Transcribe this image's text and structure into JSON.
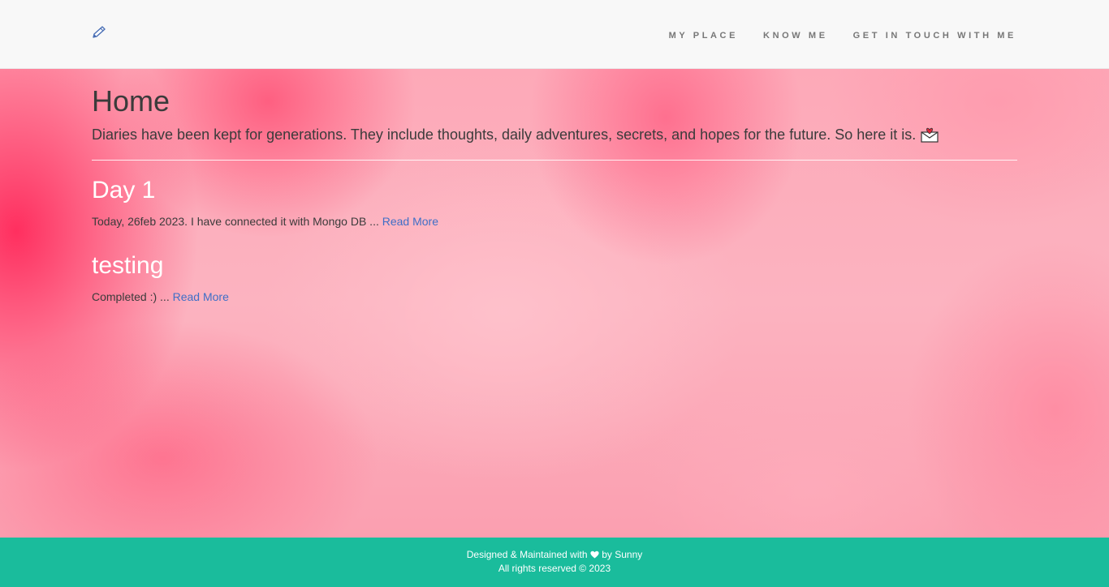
{
  "nav": {
    "brand_icon": "pencil-icon",
    "links": [
      {
        "label": "My Place"
      },
      {
        "label": "Know Me"
      },
      {
        "label": "Get in touch with me"
      }
    ]
  },
  "home": {
    "title": "Home",
    "intro": "Diaries have been kept for generations. They include thoughts, daily adventures, secrets, and hopes for the future. So here it is.",
    "intro_icon": "love-letter-icon"
  },
  "posts": [
    {
      "title": "Day 1",
      "excerpt": "Today, 26feb 2023. I have connected it with Mongo DB ... ",
      "read_more": "Read More"
    },
    {
      "title": "testing",
      "excerpt": "Completed :) ... ",
      "read_more": "Read More"
    }
  ],
  "footer": {
    "line1_prefix": "Designed & Maintained with",
    "line1_suffix": "by Sunny",
    "line2": "All rights reserved © 2023",
    "heart_icon": "heart-icon"
  },
  "colors": {
    "nav_bg": "#f8f8f8",
    "nav_link": "#777777",
    "footer_bg": "#1abc9c",
    "link": "#3f6fc7",
    "text": "#3b3b3b"
  }
}
